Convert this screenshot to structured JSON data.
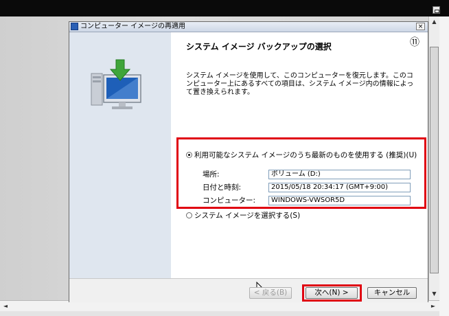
{
  "dialog": {
    "title": "コンピューター イメージの再適用",
    "close_symbol": "×",
    "circled_number": "⑪",
    "heading": "システム イメージ バックアップの選択",
    "description": "システム イメージを使用して、このコンピューターを復元します。このコンピューター上にあるすべての項目は、システム イメージ内の情報によって置き換えられます。",
    "option_latest": "利用可能なシステム イメージのうち最新のものを使用する (推奨)(U)",
    "fields": [
      {
        "label": "場所:",
        "value": "ボリューム (D:)"
      },
      {
        "label": "日付と時刻:",
        "value": "2015/05/18 20:34:17 (GMT+9:00)"
      },
      {
        "label": "コンピューター:",
        "value": "WINDOWS-VWSOR5D"
      }
    ],
    "option_select": "システム イメージを選択する(S)",
    "buttons": {
      "back": "< 戻る(B)",
      "next": "次へ(N) >",
      "cancel": "キャンセル"
    }
  },
  "colors": {
    "highlight": "#e00010",
    "left_panel": "#dfe6ef",
    "monitor_blue": "#1e5fb8",
    "arrow_green": "#3fa53a"
  },
  "icons": {
    "window": "window-icon",
    "computer": "computer-restore-icon",
    "cursor": "mouse-pointer-icon"
  },
  "scrollbars": {
    "up": "▲",
    "down": "▼",
    "left": "◄",
    "right": "►"
  }
}
